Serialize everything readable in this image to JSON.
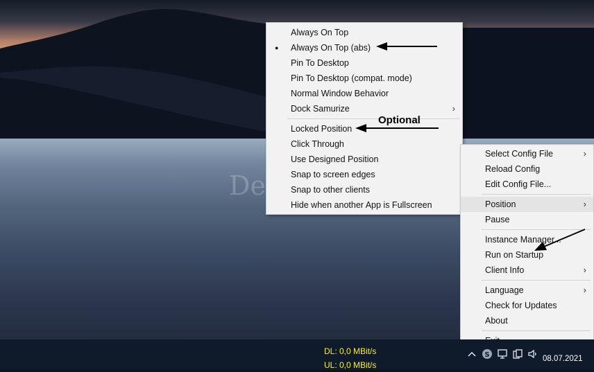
{
  "watermark": "Deskmodder.de",
  "annotation_label": "Optional",
  "position_menu": {
    "items": [
      {
        "label": "Always On Top",
        "checked": false
      },
      {
        "label": "Always On Top (abs)",
        "checked": true
      },
      {
        "label": "Pin To Desktop",
        "checked": false
      },
      {
        "label": "Pin To Desktop (compat. mode)",
        "checked": false
      },
      {
        "label": "Normal Window Behavior",
        "checked": false
      },
      {
        "label": "Dock Samurize",
        "submenu": true
      },
      {
        "label": "Locked Position"
      },
      {
        "label": "Click Through"
      },
      {
        "label": "Use Designed Position"
      },
      {
        "label": "Snap to screen edges"
      },
      {
        "label": "Snap to other clients"
      },
      {
        "label": "Hide when another App is Fullscreen"
      }
    ],
    "check_glyph": "●",
    "submenu_glyph": "›"
  },
  "tray_menu": {
    "items": [
      {
        "label": "Select Config File",
        "submenu": true
      },
      {
        "label": "Reload Config"
      },
      {
        "label": "Edit Config File..."
      },
      {
        "label": "Position",
        "submenu": true,
        "highlighted": true
      },
      {
        "label": "Pause"
      },
      {
        "label": "Instance Manager..."
      },
      {
        "label": "Run on Startup"
      },
      {
        "label": "Client Info",
        "submenu": true
      },
      {
        "label": "Language",
        "submenu": true
      },
      {
        "label": "Check for Updates"
      },
      {
        "label": "About"
      },
      {
        "label": "Exit"
      }
    ]
  },
  "taskbar": {
    "download": "DL: 0,0 MBit/s",
    "upload": "UL: 0,0 MBit/s",
    "date": "08.07.2021",
    "icons": [
      "chevron-up-icon",
      "app-s-icon",
      "network-icon",
      "copy-icon",
      "speaker-icon"
    ]
  },
  "colors": {
    "netmeter": "#f5f02a",
    "menu_bg": "#f2f2f2",
    "taskbar": "#0f1a2a"
  }
}
